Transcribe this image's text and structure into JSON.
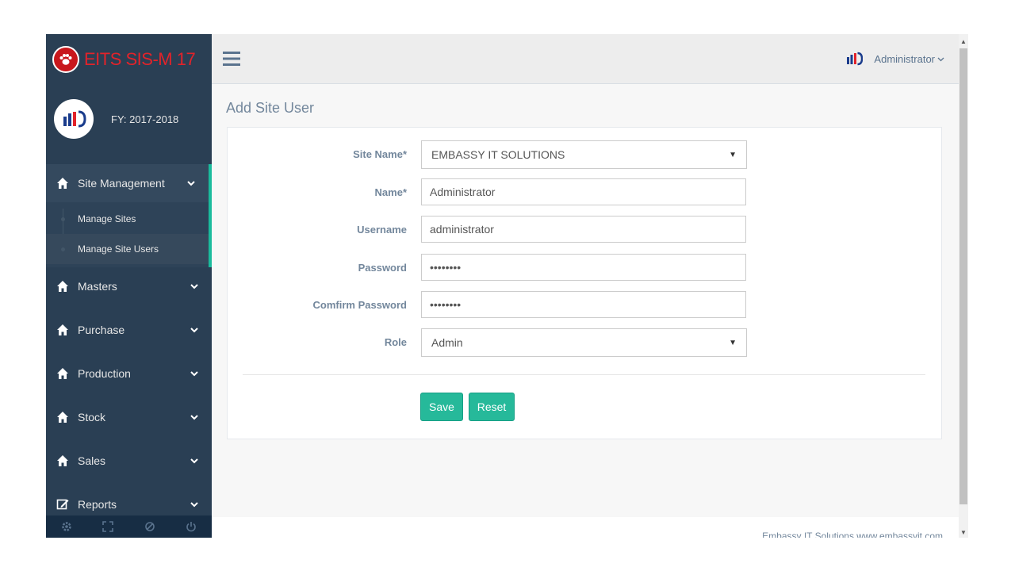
{
  "brand": {
    "title": "EITS SIS-M 17"
  },
  "profile": {
    "fy": "FY: 2017-2018"
  },
  "sidebar": {
    "items": [
      {
        "label": "Site Management",
        "active": true,
        "children": [
          {
            "label": "Manage Sites"
          },
          {
            "label": "Manage Site Users",
            "current": true
          }
        ]
      },
      {
        "label": "Masters"
      },
      {
        "label": "Purchase"
      },
      {
        "label": "Production"
      },
      {
        "label": "Stock"
      },
      {
        "label": "Sales"
      },
      {
        "label": "Reports"
      }
    ],
    "footer_icons": [
      "settings-icon",
      "fullscreen-icon",
      "lock-icon",
      "logout-icon"
    ]
  },
  "topnav": {
    "user": "Administrator"
  },
  "page": {
    "title": "Add Site User"
  },
  "form": {
    "site_name": {
      "label": "Site Name*",
      "value": "EMBASSY IT SOLUTIONS"
    },
    "name": {
      "label": "Name*",
      "value": "Administrator"
    },
    "username": {
      "label": "Username",
      "value": "administrator"
    },
    "password": {
      "label": "Password",
      "value": "••••••••"
    },
    "confirm_password": {
      "label": "Comfirm Password",
      "value": "••••••••"
    },
    "role": {
      "label": "Role",
      "value": "Admin"
    },
    "save_label": "Save",
    "reset_label": "Reset"
  },
  "footer": {
    "text": "Embassy IT Solutions www.embassyit.com"
  },
  "colors": {
    "sidebar": "#2a3f54",
    "accent": "#1abb9c",
    "button": "#26b99a",
    "brand": "#e2232a"
  }
}
